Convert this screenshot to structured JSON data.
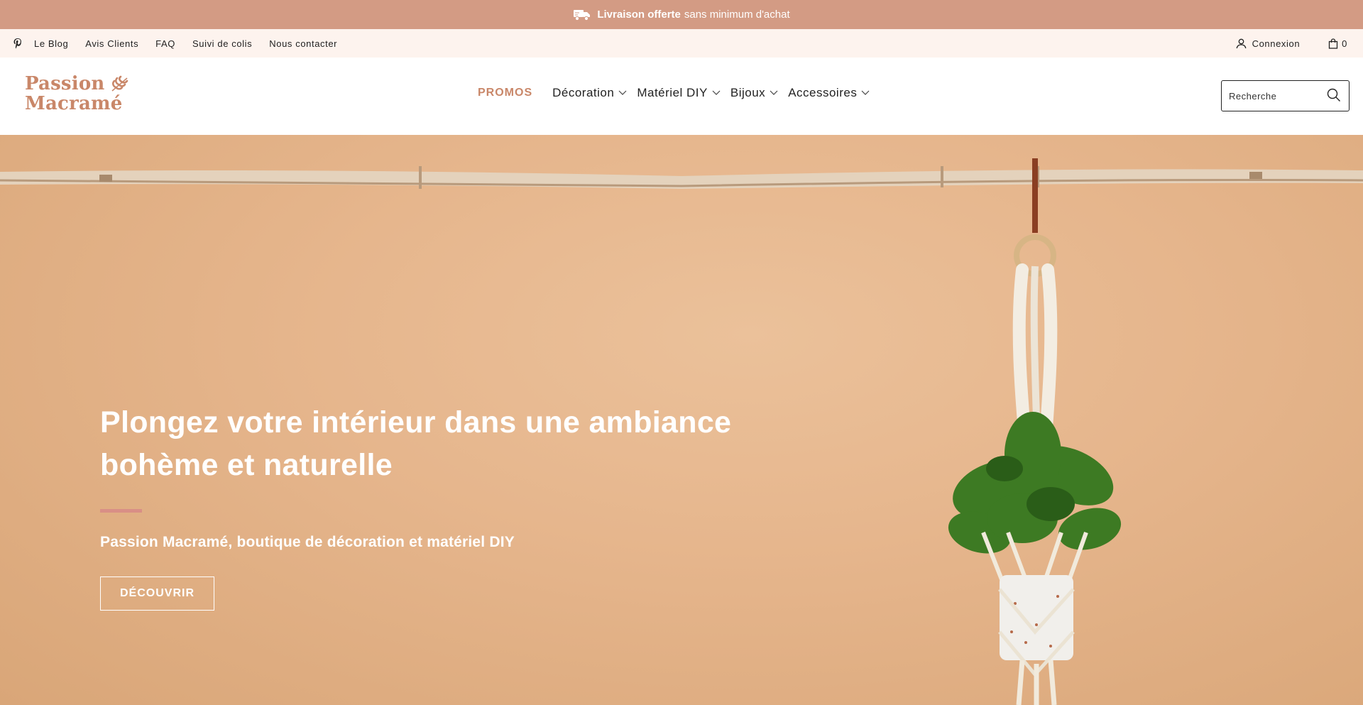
{
  "announcement": {
    "bold": "Livraison offerte",
    "text": "sans minimum d'achat",
    "icon": "truck-icon"
  },
  "utility": {
    "links": [
      "Le Blog",
      "Avis Clients",
      "FAQ",
      "Suivi de colis",
      "Nous contacter"
    ],
    "login": "Connexion",
    "cart_count": "0"
  },
  "header": {
    "logo_line1": "Passion",
    "logo_line2": "Macramé",
    "promo": "PROMOS",
    "nav": [
      "Décoration",
      "Matériel DIY",
      "Bijoux",
      "Accessoires"
    ],
    "search_placeholder": "Recherche"
  },
  "hero": {
    "title": "Plongez votre intérieur dans une ambiance bohème et naturelle",
    "subtitle": "Passion Macramé, boutique de décoration et matériel DIY",
    "button": "DÉCOUVRIR"
  },
  "colors": {
    "announce_bg": "#d39b84",
    "utility_bg": "#fdf3ee",
    "brand": "#c98769",
    "hero_bg": "#e6b68d",
    "accent_rule": "#d98f86"
  }
}
